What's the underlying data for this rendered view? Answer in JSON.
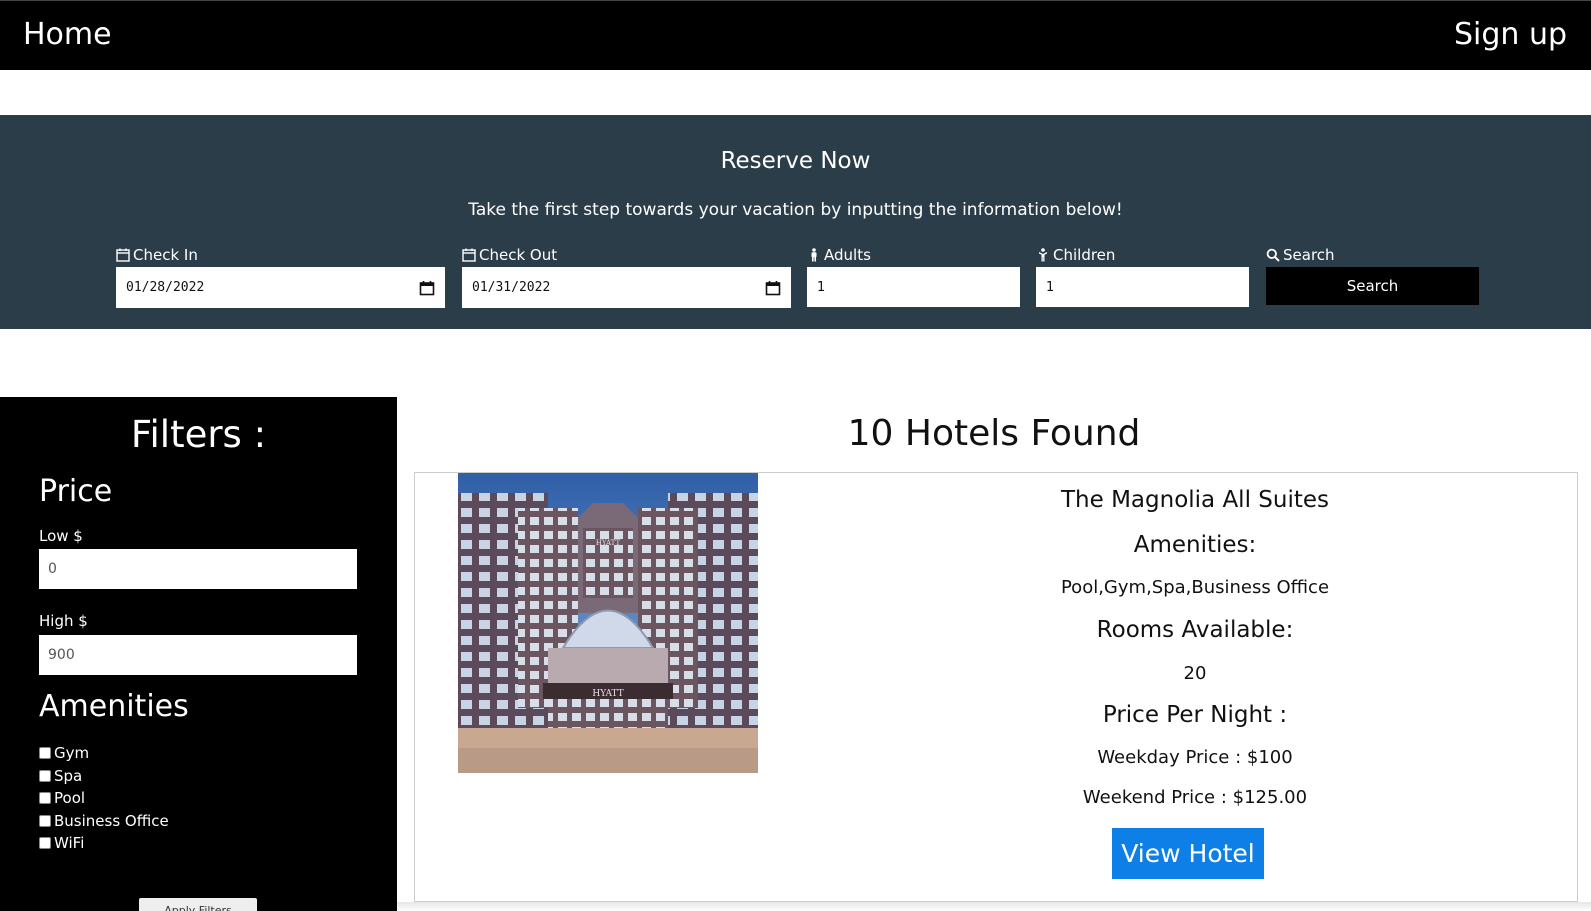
{
  "nav": {
    "home": "Home",
    "signup": "Sign up"
  },
  "reserve": {
    "title": "Reserve Now",
    "subtitle": "Take the first step towards your vacation by inputting the information below!",
    "checkin_label": "Check In",
    "checkin_value": "01/28/2022",
    "checkout_label": "Check Out",
    "checkout_value": "01/31/2022",
    "adults_label": "Adults",
    "adults_value": "1",
    "children_label": "Children",
    "children_value": "1",
    "search_label": "Search",
    "search_button": "Search"
  },
  "filters": {
    "title": "Filters :",
    "price_heading": "Price",
    "low_label": "Low $",
    "low_value": "0",
    "high_label": "High $",
    "high_value": "900",
    "amenities_heading": "Amenities",
    "amenities": [
      "Gym",
      "Spa",
      "Pool",
      "Business Office",
      "WiFi"
    ],
    "apply_button": "Apply Filters"
  },
  "results": {
    "count_title": "10 Hotels Found",
    "hotel": {
      "name": "The Magnolia All Suites",
      "amenities_label": "Amenities:",
      "amenities_value": "Pool,Gym,Spa,Business Office",
      "rooms_label": "Rooms Available:",
      "rooms_value": "20",
      "price_label": "Price Per Night :",
      "weekday_price": "Weekday Price : $100",
      "weekend_price": "Weekend Price : $125.00",
      "view_button": "View Hotel",
      "image_sign_top": "HYATT",
      "image_sign_bottom": "HYATT"
    }
  }
}
